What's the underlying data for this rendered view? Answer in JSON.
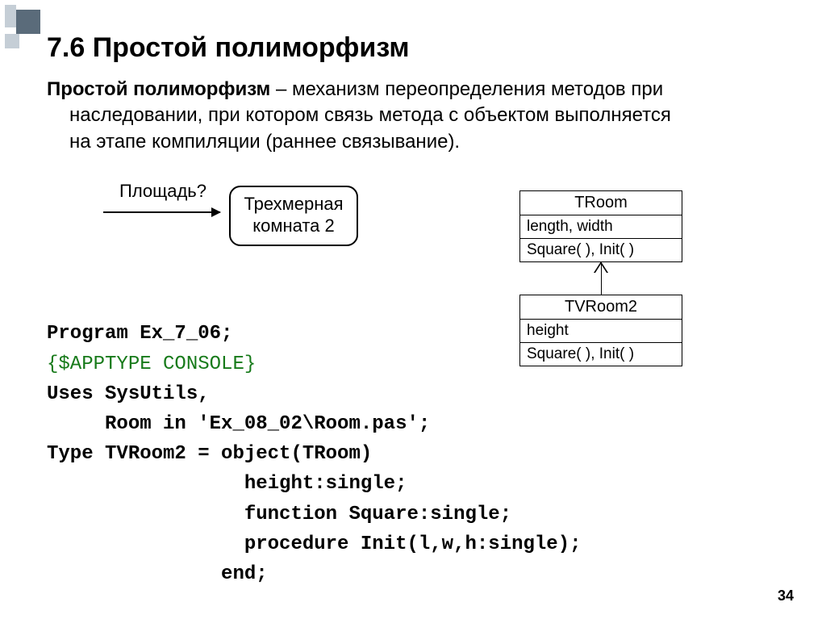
{
  "title": "7.6 Простой полиморфизм",
  "definition": {
    "term": "Простой полиморфизм",
    "sep": " – ",
    "rest_line1": "механизм переопределения методов при",
    "cont_line2": "наследовании, при котором связь метода с объектом выполняется",
    "cont_line3": "на этапе компиляции (раннее связывание)."
  },
  "diagram": {
    "question": "Площадь?",
    "box_line1": "Трехмерная",
    "box_line2": "комната 2"
  },
  "uml": {
    "class1": {
      "name": "TRoom",
      "attr": "length, width",
      "ops": "Square( ), Init( )"
    },
    "class2": {
      "name": "TVRoom2",
      "attr": "height",
      "ops": "Square( ), Init( )"
    }
  },
  "code": {
    "l1": "Program Ex_7_06;",
    "l2": "{$APPTYPE CONSOLE}",
    "l3": "Uses SysUtils,",
    "l4": "     Room in 'Ex_08_02\\Room.pas';",
    "l5": "Type TVRoom2 = object(TRoom)",
    "l6": "                 height:single;",
    "l7": "                 function Square:single;",
    "l8": "                 procedure Init(l,w,h:single);",
    "l9": "               end;"
  },
  "page_number": "34"
}
